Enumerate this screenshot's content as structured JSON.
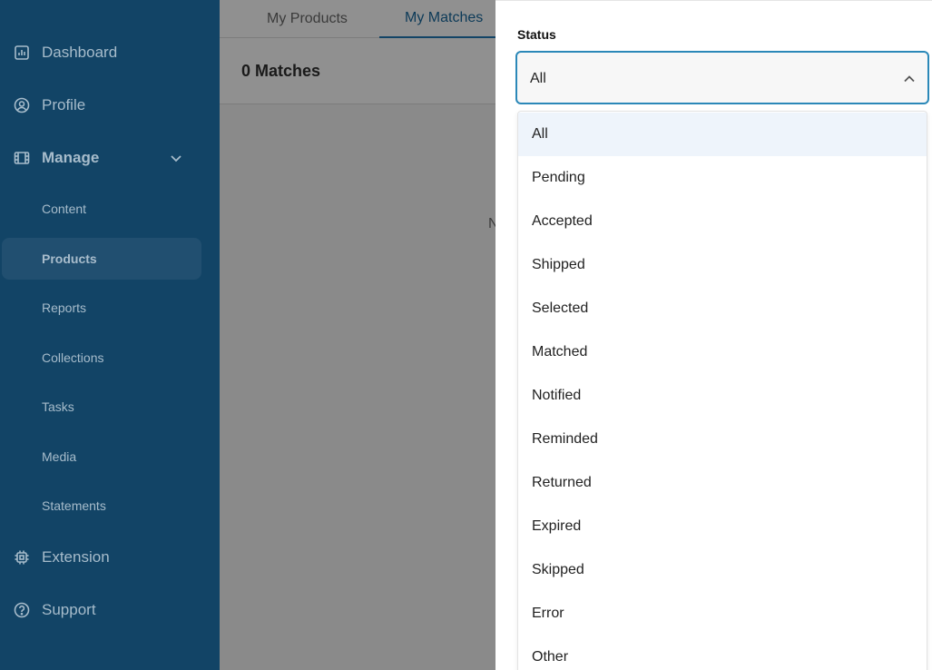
{
  "sidebar": {
    "items": [
      {
        "label": "Dashboard",
        "icon": "chart-icon"
      },
      {
        "label": "Profile",
        "icon": "user-circle-icon"
      },
      {
        "label": "Manage",
        "icon": "film-icon",
        "expanded": true
      },
      {
        "label": "Extension",
        "icon": "chip-icon"
      },
      {
        "label": "Support",
        "icon": "help-icon"
      }
    ],
    "sub_items": [
      {
        "label": "Content"
      },
      {
        "label": "Products",
        "active": true
      },
      {
        "label": "Reports"
      },
      {
        "label": "Collections"
      },
      {
        "label": "Tasks"
      },
      {
        "label": "Media"
      },
      {
        "label": "Statements"
      }
    ]
  },
  "main": {
    "tabs": [
      {
        "label": "My Products"
      },
      {
        "label": "My Matches",
        "active": true
      }
    ],
    "matches_count": "0 Matches",
    "empty_text": "N"
  },
  "filter_panel": {
    "status_label": "Status",
    "selected_value": "All",
    "options": [
      "All",
      "Pending",
      "Accepted",
      "Shipped",
      "Selected",
      "Matched",
      "Notified",
      "Reminded",
      "Returned",
      "Expired",
      "Skipped",
      "Error",
      "Other"
    ]
  },
  "colors": {
    "sidebar_bg": "#124466",
    "accent": "#2b88b8",
    "overlay": "#8a8a8a",
    "selected_option_bg": "#eef4fb"
  }
}
